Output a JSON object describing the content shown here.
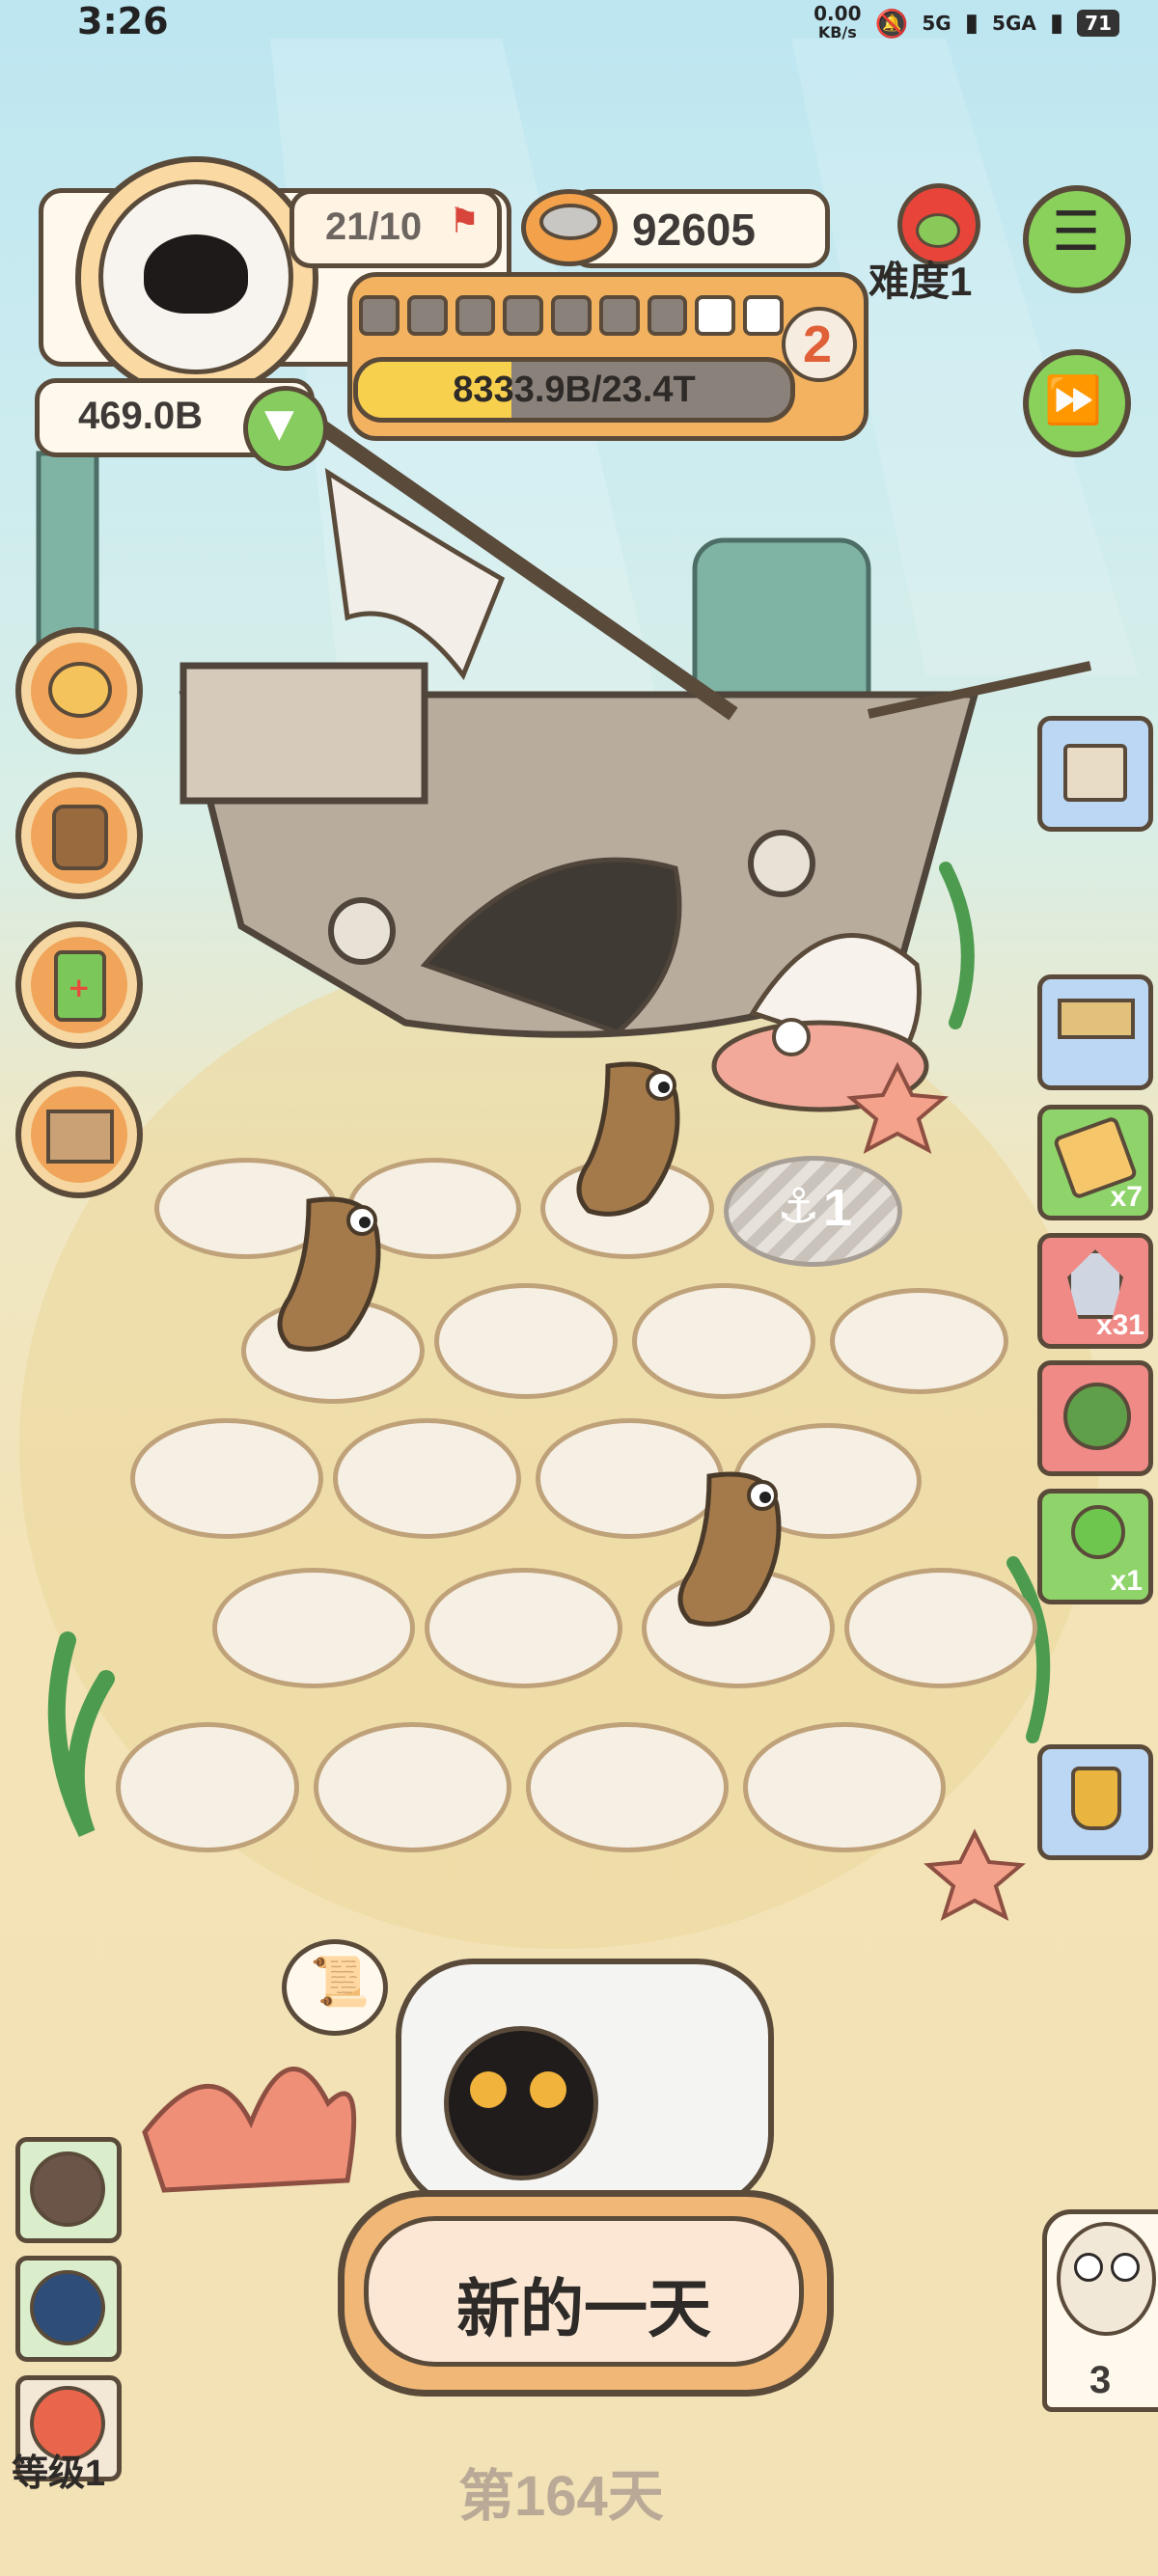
{
  "status_bar": {
    "time": "3:26",
    "network_speed": "0.00",
    "network_unit": "KB/s",
    "signal_1": "5G",
    "signal_2": "5GA",
    "battery": "71"
  },
  "player": {
    "stage_progress": "21/10",
    "coins": "92605",
    "resource": "469.0B",
    "level_badge": "2",
    "progress_bar_text": "8333.9B/23.4T",
    "progress_fraction": 0.356,
    "segments_total": 9,
    "segments_filled": 7
  },
  "difficulty": {
    "label": "难度1"
  },
  "side_items": {
    "ticket_count": "x7",
    "crystal_count": "x31",
    "candy_count": "x1"
  },
  "new_day_button": {
    "label": "新的一天"
  },
  "slot_badge": {
    "value": "1"
  },
  "day_counter": {
    "label": "第164天"
  },
  "level_label": "等级1",
  "owl_counter": "3",
  "colors": {
    "accent_orange": "#f3b25f",
    "accent_green": "#8ed35c",
    "panel_border": "#5a4a3a"
  }
}
